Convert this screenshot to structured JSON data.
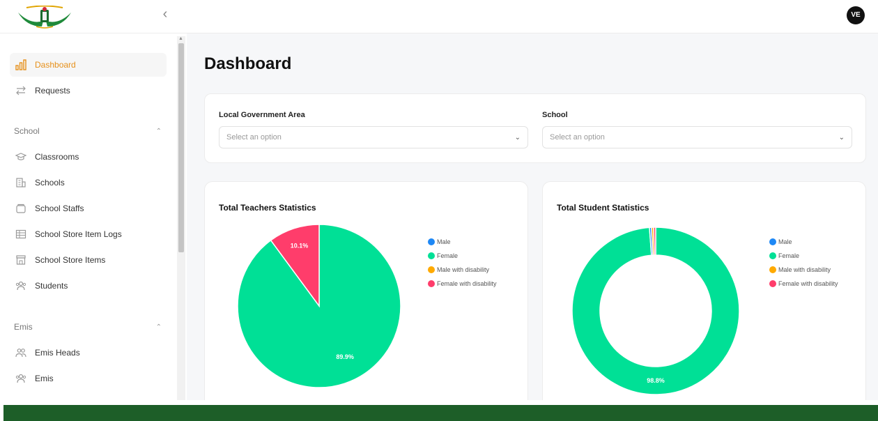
{
  "header": {
    "collapse_icon": "chevron-left-icon",
    "avatar_initials": "VE"
  },
  "sidebar": {
    "items_top": [
      {
        "label": "Dashboard",
        "icon": "bar-chart-icon",
        "active": true
      },
      {
        "label": "Requests",
        "icon": "swap-arrows-icon",
        "active": false
      }
    ],
    "sections": [
      {
        "title": "School",
        "items": [
          {
            "label": "Classrooms",
            "icon": "graduation-cap-icon"
          },
          {
            "label": "Schools",
            "icon": "building-icon"
          },
          {
            "label": "School Staffs",
            "icon": "folder-icon"
          },
          {
            "label": "School Store Item Logs",
            "icon": "table-icon"
          },
          {
            "label": "School Store Items",
            "icon": "store-icon"
          },
          {
            "label": "Students",
            "icon": "users-icon"
          }
        ]
      },
      {
        "title": "Emis",
        "items": [
          {
            "label": "Emis Heads",
            "icon": "user-group-icon"
          },
          {
            "label": "Emis",
            "icon": "users-icon"
          }
        ]
      }
    ]
  },
  "main": {
    "title": "Dashboard",
    "filters": {
      "lga_label": "Local Government Area",
      "lga_placeholder": "Select an option",
      "school_label": "School",
      "school_placeholder": "Select an option"
    }
  },
  "colors": {
    "male": "#1e88f5",
    "female": "#00e096",
    "male_disability": "#ffaa00",
    "female_disability": "#ff3d6b",
    "accent": "#e6901a",
    "footer": "#1d5e28"
  },
  "chart_data": [
    {
      "type": "pie",
      "title": "Total Teachers Statistics",
      "categories": [
        "Male",
        "Female",
        "Male with disability",
        "Female with disability"
      ],
      "values": [
        0,
        89.9,
        0,
        10.1
      ],
      "data_labels": [
        "",
        "89.9%",
        "",
        "10.1%"
      ],
      "legend_position": "right"
    },
    {
      "type": "pie",
      "subtype": "donut",
      "title": "Total Student Statistics",
      "categories": [
        "Male",
        "Female",
        "Male with disability",
        "Female with disability"
      ],
      "values": [
        0.4,
        98.8,
        0.4,
        0.4
      ],
      "data_labels": [
        "",
        "98.8%",
        "",
        ""
      ],
      "legend_position": "right"
    }
  ]
}
